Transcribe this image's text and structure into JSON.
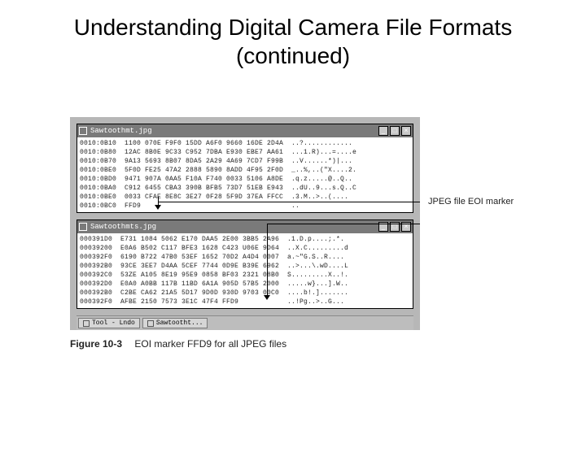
{
  "title": "Understanding Digital Camera File Formats (continued)",
  "win1": {
    "filename": "Sawtoothmt.jpg",
    "rows": [
      "0010:0B10  1100 070E F9F0 15DD A6F0 9660 16DE 2D4A  ..?............",
      "0010:0B80  12AC 8B0E 9C33 C952 7DBA E930 EBE7 AA61  ...1.R)...=....e",
      "0010:0B70  9A13 5693 8B07 8DA5 2A29 4A69 7CD7 F99B  ..V......*)|...",
      "0010:0BE0  5F0D FE25 47A2 2888 5890 8ADD 4F95 2F0D  _..%,..(\"X....2.",
      "0010:0BD0  9471 907A 0AA5 F10A F740 0033 5106 A8DE  .q.z.....@..Q..",
      "0010:0BA0  C912 6455 CBA3 390B BFB5 73D7 51EB E943  ..dU..9...s.Q..C",
      "0010:0BE0  0033 CFAE 8E8C 3E27 0F28 5F9D 37EA FFCC  .3.M..>..(....",
      "0010:0BC0  FFD9                                     .."
    ]
  },
  "win2": {
    "filename": "Sawtoothmts.jpg",
    "rows": [
      "000391D0  E731 1084 5062 E170 DAA5 2E00 3BB5 2A96  .1.D.p....;.*.",
      "00039200  E0A6 B502 C117 BFE3 1628 C423 U06E 9D64  ..X.C.........d",
      "000392F0  6190 B722 47B0 53EF 1652 70D2 A4D4 0007  a.~\"G.S..R....",
      "000392B0  93CE 3EE7 D4AA 5CEF 7744 0D9E B39E 6962  ..>...\\.wD....L",
      "000392C0  53ZE A105 8E19 95E9 0858 BF03 2321 08B0  S.........X..!.",
      "000392D0  E0A0 A0BB 117B 11BD 6A1A 905D 57B5 2000  .....w}...].W..",
      "000392B0  C2BE CA62 21A5 5D17 9D0D 930D 9703 00C0  ....b!.].......",
      "000392F0  AFBE 2150 7573 3E1C 47F4 FFD9            ..!Pg..>..G..."
    ]
  },
  "taskbar": {
    "btn1": "Tool - Lndo",
    "btn2": "Sawtootht..."
  },
  "callout": "JPEG file EOI marker",
  "caption_fig": "Figure 10-3",
  "caption_text": "EOI marker FFD9 for all JPEG files"
}
